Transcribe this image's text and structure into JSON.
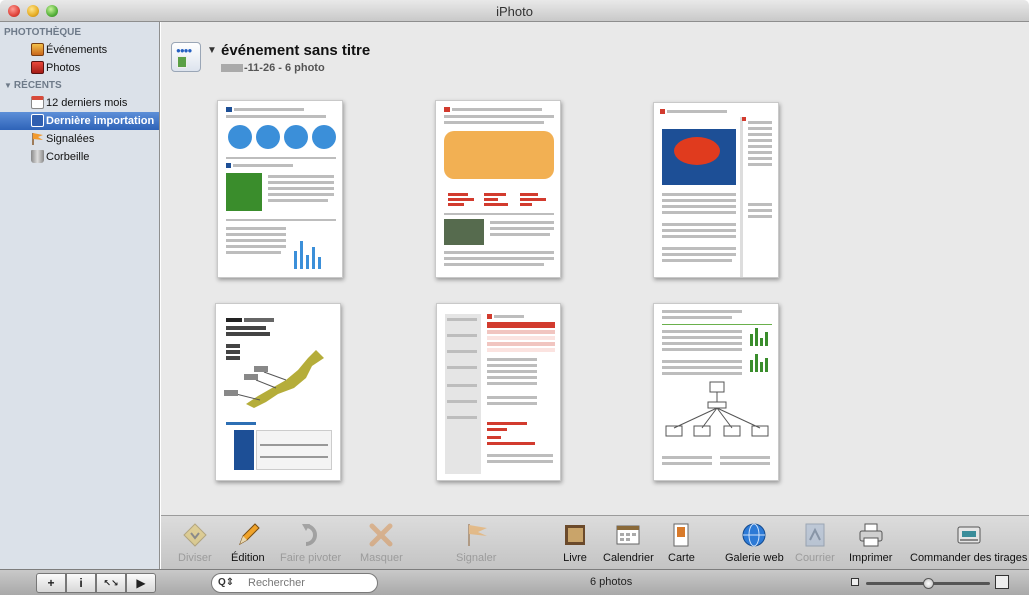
{
  "window": {
    "title": "iPhoto"
  },
  "sidebar": {
    "library_header": "PHOTOTHÈQUE",
    "library_items": [
      {
        "label": "Événements",
        "icon": "events-icon"
      },
      {
        "label": "Photos",
        "icon": "photos-icon"
      }
    ],
    "recents_header": "RÉCENTS",
    "recents_items": [
      {
        "label": "12 derniers mois",
        "icon": "calendar-icon"
      },
      {
        "label": "Dernière importation",
        "icon": "import-icon",
        "selected": true
      },
      {
        "label": "Signalées",
        "icon": "flag-icon"
      },
      {
        "label": "Corbeille",
        "icon": "trash-icon"
      }
    ]
  },
  "event": {
    "title": "événement sans titre",
    "subtitle": "-11-26 - 6 photo"
  },
  "photos": [
    {
      "name": "infographic-pie-map-bar"
    },
    {
      "name": "infographic-world-map"
    },
    {
      "name": "infographic-pie-report"
    },
    {
      "name": "infographic-japan-map-table"
    },
    {
      "name": "infographic-red-table"
    },
    {
      "name": "infographic-network-diagram"
    }
  ],
  "toolbar": {
    "items": [
      {
        "label": "Diviser",
        "icon": "split-icon",
        "enabled": false
      },
      {
        "label": "Édition",
        "icon": "pencil-icon",
        "enabled": true
      },
      {
        "label": "Faire pivoter",
        "icon": "rotate-icon",
        "enabled": false
      },
      {
        "label": "Masquer",
        "icon": "hide-x-icon",
        "enabled": false
      },
      {
        "label": "Signaler",
        "icon": "flag-icon",
        "enabled": false
      },
      {
        "label": "Livre",
        "icon": "book-icon",
        "enabled": true
      },
      {
        "label": "Calendrier",
        "icon": "calendar-icon",
        "enabled": true
      },
      {
        "label": "Carte",
        "icon": "card-icon",
        "enabled": true
      },
      {
        "label": "Galerie web",
        "icon": "globe-icon",
        "enabled": true
      },
      {
        "label": "Courrier",
        "icon": "mail-icon",
        "enabled": false
      },
      {
        "label": "Imprimer",
        "icon": "printer-icon",
        "enabled": true
      },
      {
        "label": "Commander des tirages",
        "icon": "order-prints-icon",
        "enabled": true
      }
    ]
  },
  "statusbar": {
    "buttons": [
      "+",
      "i",
      "↖↘",
      "▶"
    ],
    "search_placeholder": "Rechercher",
    "photo_count": "6 photos",
    "zoom_level": 0.5
  },
  "colors": {
    "selection": "#2e63b8",
    "sidebar_bg": "#dbe1e9",
    "browser_bg": "#e9e9e9"
  }
}
